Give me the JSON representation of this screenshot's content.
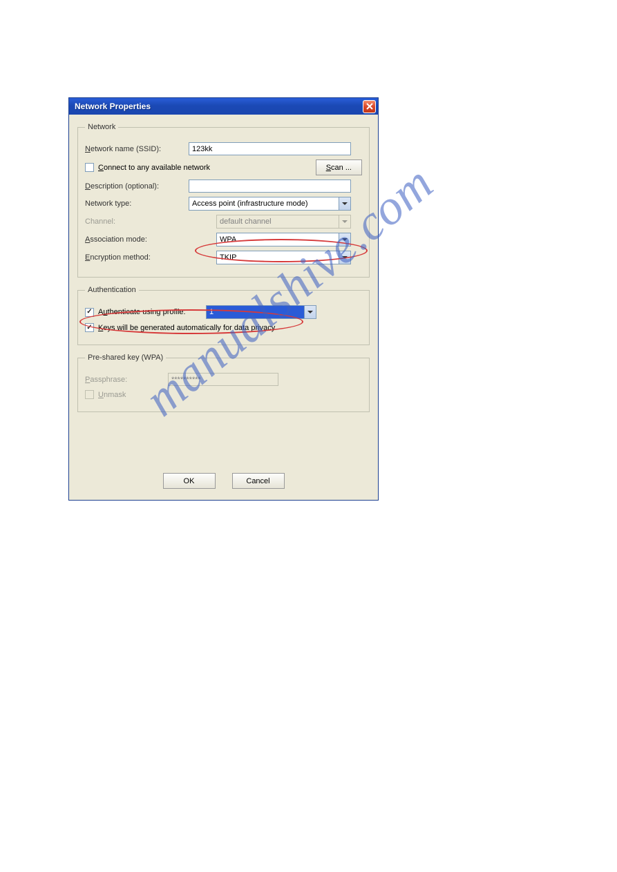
{
  "dialog": {
    "title": "Network Properties"
  },
  "network": {
    "legend": "Network",
    "ssid_label_pre": "N",
    "ssid_label_post": "etwork name (SSID):",
    "ssid_value": "123kk",
    "connect_any_pre": "C",
    "connect_any_post": "onnect to any available network",
    "scan_pre": "S",
    "scan_post": "can ...",
    "description_pre": "D",
    "description_post": "escription (optional):",
    "description_value": "",
    "nettype_label": "Network type:",
    "nettype_value": "Access point (infrastructure mode)",
    "channel_label": "Channel:",
    "channel_value": "default channel",
    "assoc_pre": "A",
    "assoc_post": "ssociation mode:",
    "assoc_value": "WPA",
    "encr_pre": "E",
    "encr_post": "ncryption method:",
    "encr_value": "TKIP"
  },
  "auth": {
    "legend": "Authentication",
    "auth_profile_pre": "A",
    "auth_profile_mid": "u",
    "auth_profile_post": "thenticate using profile:",
    "auth_profile_value": "1",
    "keys_auto_pre": "K",
    "keys_auto_post": "eys will be generated automatically for data privacy"
  },
  "psk": {
    "legend": "Pre-shared key (WPA)",
    "pass_pre": "P",
    "pass_post": "assphrase:",
    "pass_value": "**********",
    "unmask_pre": "U",
    "unmask_post": "nmask"
  },
  "buttons": {
    "ok": "OK",
    "cancel": "Cancel"
  },
  "watermark": "manualshive.com"
}
